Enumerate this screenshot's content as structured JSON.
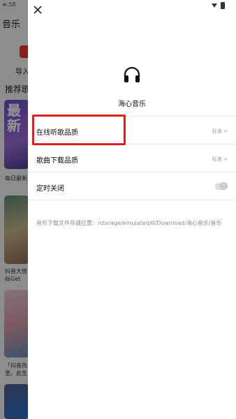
{
  "background_app": {
    "status_time": "≡:58",
    "title": "音乐",
    "import_label": "导入",
    "section_title": "推荐歌",
    "card1_text": "最新",
    "captions": [
      "每日最新",
      "抖音大放\n标Get",
      "「抖音热\n里。此生"
    ]
  },
  "drawer": {
    "app_name": "海心音乐",
    "settings": [
      {
        "label": "在线听歌品质",
        "value": "标准 >"
      },
      {
        "label": "歌曲下载品质",
        "value": "标准 >"
      },
      {
        "label": "定时关闭",
        "toggle_on": false
      }
    ],
    "storage_note": "音乐下载文件存储位置：/storage/emulated/0/Download/海心音乐/音乐"
  },
  "colors": {
    "highlight": "#e0201e",
    "dim_overlay": "rgba(0,0,0,0.42)"
  },
  "icons": [
    "close-icon",
    "headphone-icon",
    "wifi-icon",
    "battery-icon"
  ]
}
